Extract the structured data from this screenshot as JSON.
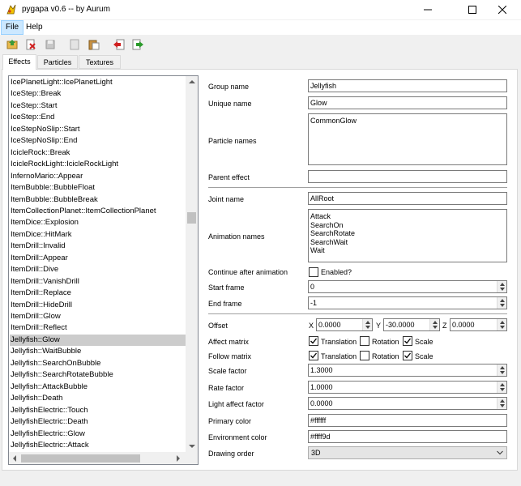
{
  "window": {
    "title": "pygapa v0.6 -- by Aurum"
  },
  "menu": {
    "file": "File",
    "help": "Help"
  },
  "toolbar": {
    "icons": [
      "open-folder-icon",
      "close-file-icon",
      "save-icon",
      "new-icon",
      "paste-icon",
      "import-icon",
      "export-icon"
    ]
  },
  "tabs": [
    "Effects",
    "Particles",
    "Textures"
  ],
  "effects_list": {
    "items": [
      "IcePlanetLight::IcePlanetLight",
      "IceStep::Break",
      "IceStep::Start",
      "IceStep::End",
      "IceStepNoSlip::Start",
      "IceStepNoSlip::End",
      "IcicleRock::Break",
      "IcicleRockLight::IcicleRockLight",
      "InfernoMario::Appear",
      "ItemBubble::BubbleFloat",
      "ItemBubble::BubbleBreak",
      "ItemCollectionPlanet::ItemCollectionPlanet",
      "ItemDice::Explosion",
      "ItemDice::HitMark",
      "ItemDrill::Invalid",
      "ItemDrill::Appear",
      "ItemDrill::Dive",
      "ItemDrill::VanishDrill",
      "ItemDrill::Replace",
      "ItemDrill::HideDrill",
      "ItemDrill::Glow",
      "ItemDrill::Reflect",
      "Jellyfish::Glow",
      "Jellyfish::WaitBubble",
      "Jellyfish::SearchOnBubble",
      "Jellyfish::SearchRotateBubble",
      "Jellyfish::AttackBubble",
      "Jellyfish::Death",
      "JellyfishElectric::Touch",
      "JellyfishElectric::Death",
      "JellyfishElectric::Glow",
      "JellyfishElectric::Attack"
    ],
    "selected_index": 22
  },
  "form": {
    "group_name": {
      "label": "Group name",
      "value": "Jellyfish"
    },
    "unique_name": {
      "label": "Unique name",
      "value": "Glow"
    },
    "particle_names": {
      "label": "Particle names",
      "values": [
        "CommonGlow"
      ]
    },
    "parent_effect": {
      "label": "Parent effect",
      "value": ""
    },
    "joint_name": {
      "label": "Joint name",
      "value": "AllRoot"
    },
    "animation_names": {
      "label": "Animation names",
      "values": [
        "Attack",
        "SearchOn",
        "SearchRotate",
        "SearchWait",
        "Wait"
      ]
    },
    "continue_after_animation": {
      "label": "Continue after animation",
      "checkbox_label": "Enabled?",
      "checked": false
    },
    "start_frame": {
      "label": "Start frame",
      "value": "0"
    },
    "end_frame": {
      "label": "End frame",
      "value": "-1"
    },
    "offset": {
      "label": "Offset",
      "x_label": "X",
      "y_label": "Y",
      "z_label": "Z",
      "x": "0.0000",
      "y": "-30.0000",
      "z": "0.0000"
    },
    "affect_matrix": {
      "label": "Affect matrix",
      "translation": "Translation",
      "rotation": "Rotation",
      "scale": "Scale",
      "translation_checked": true,
      "rotation_checked": false,
      "scale_checked": true
    },
    "follow_matrix": {
      "label": "Follow matrix",
      "translation": "Translation",
      "rotation": "Rotation",
      "scale": "Scale",
      "translation_checked": true,
      "rotation_checked": false,
      "scale_checked": true
    },
    "scale_factor": {
      "label": "Scale factor",
      "value": "1.3000"
    },
    "rate_factor": {
      "label": "Rate factor",
      "value": "1.0000"
    },
    "light_affect_factor": {
      "label": "Light affect factor",
      "value": "0.0000"
    },
    "primary_color": {
      "label": "Primary color",
      "value": "#ffffff"
    },
    "environment_color": {
      "label": "Environment color",
      "value": "#ffff9d"
    },
    "drawing_order": {
      "label": "Drawing order",
      "value": "3D"
    }
  }
}
